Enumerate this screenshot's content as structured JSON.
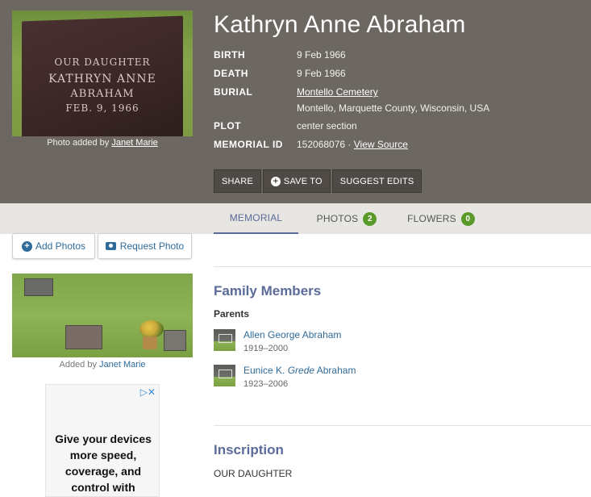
{
  "memorial": {
    "name": "Kathryn Anne Abraham",
    "headstone_text": [
      "OUR DAUGHTER",
      "KATHRYN ANNE",
      "ABRAHAM",
      "FEB. 9, 1966"
    ],
    "photo_caption_prefix": "Photo added by",
    "photo_added_by": "Janet Marie",
    "facts": {
      "birth_label": "BIRTH",
      "birth_value": "9 Feb 1966",
      "death_label": "DEATH",
      "death_value": "9 Feb 1966",
      "burial_label": "BURIAL",
      "burial_cemetery": "Montello Cemetery",
      "burial_location": "Montello, Marquette County, Wisconsin, USA",
      "plot_label": "PLOT",
      "plot_value": "center section",
      "memorial_id_label": "MEMORIAL ID",
      "memorial_id_value": "152068076 ·",
      "view_source": "View Source"
    },
    "actions": {
      "share": "SHARE",
      "save_to": "SAVE TO",
      "suggest_edits": "SUGGEST EDITS"
    }
  },
  "tabs": [
    {
      "label": "MEMORIAL",
      "active": true
    },
    {
      "label": "PHOTOS",
      "count": "2"
    },
    {
      "label": "FLOWERS",
      "count": "0"
    }
  ],
  "sidebar": {
    "add_photos": "Add Photos",
    "request_photo": "Request Photo",
    "photo_caption_prefix": "Added by",
    "photo_added_by": "Janet Marie"
  },
  "ad": {
    "text": "Give your devices more speed, coverage, and control with"
  },
  "family": {
    "title": "Family Members",
    "parents_label": "Parents",
    "parents": [
      {
        "name": "Allen George Abraham",
        "dates": "1919–2000"
      },
      {
        "name_first": "Eunice K.",
        "name_maiden": "Grede",
        "name_last": "Abraham",
        "dates": "1923–2006"
      }
    ]
  },
  "inscription": {
    "title": "Inscription",
    "text": "OUR DAUGHTER"
  },
  "colors": {
    "header_bg": "#6d6761",
    "accent": "#5b6b9a",
    "link": "#2f6b9a",
    "badge": "#5a9a2a"
  }
}
